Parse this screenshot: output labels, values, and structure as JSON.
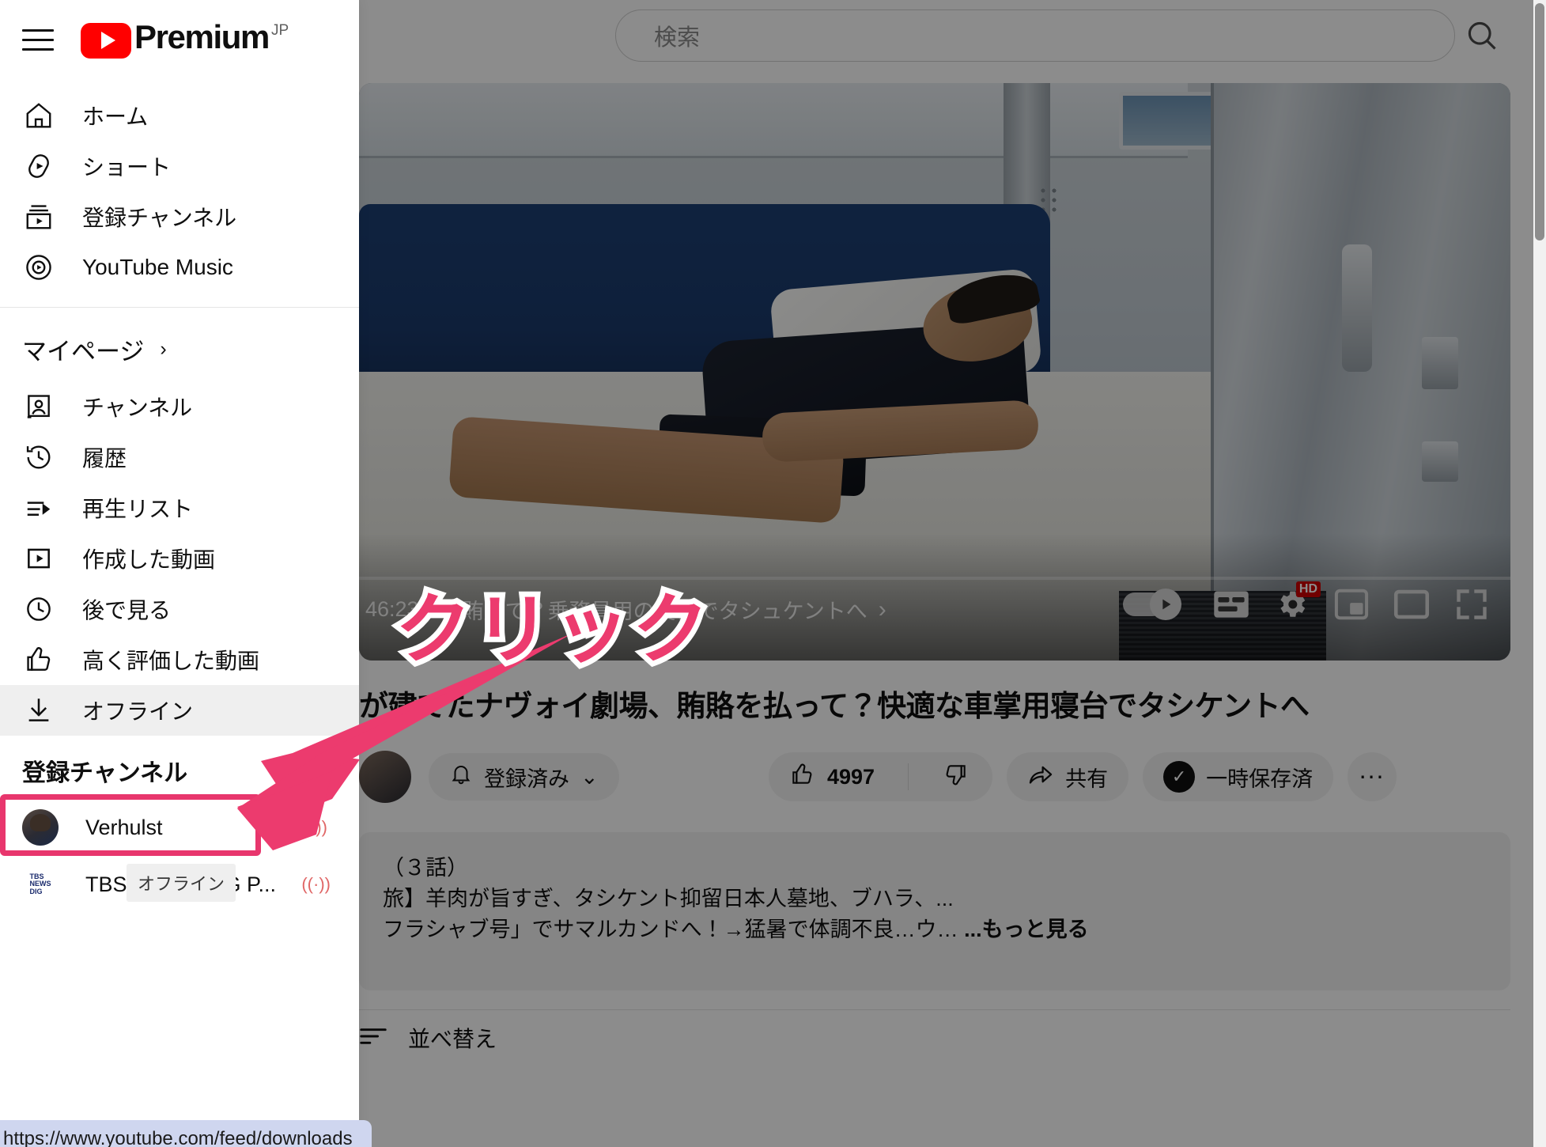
{
  "masthead": {
    "menu_icon": "hamburger-icon",
    "brand": {
      "word": "Premium",
      "superscript": "JP",
      "logo": "youtube-play-logo"
    },
    "search": {
      "placeholder": "検索",
      "value": "",
      "search_icon": "search-icon"
    }
  },
  "sidebar": {
    "primary_items": [
      {
        "label": "ホーム",
        "icon": "home-icon"
      },
      {
        "label": "ショート",
        "icon": "shorts-icon"
      },
      {
        "label": "登録チャンネル",
        "icon": "subscriptions-icon"
      },
      {
        "label": "YouTube Music",
        "icon": "youtube-music-icon"
      }
    ],
    "you_section": {
      "header": "マイページ",
      "chevron": "chevron-right-icon"
    },
    "you_items": [
      {
        "label": "チャンネル",
        "icon": "channel-icon"
      },
      {
        "label": "履歴",
        "icon": "history-icon"
      },
      {
        "label": "再生リスト",
        "icon": "playlist-icon"
      },
      {
        "label": "作成した動画",
        "icon": "your-videos-icon"
      },
      {
        "label": "後で見る",
        "icon": "watch-later-icon"
      },
      {
        "label": "高く評価した動画",
        "icon": "thumbs-up-icon"
      },
      {
        "label": "オフライン",
        "icon": "download-icon"
      }
    ],
    "highlighted_item": "オフライン",
    "tooltip": "オフライン",
    "subscriptions_header": "登録チャンネル",
    "subscriptions": [
      {
        "name": "Verhulst",
        "avatar": "verhulst-avatar",
        "live": true,
        "live_icon": "live-broadcast-icon"
      },
      {
        "name": "TBS NEWS DIG P...",
        "avatar": "tbs-news-dig-avatar",
        "live": true,
        "live_icon": "live-broadcast-icon",
        "logo_lines": [
          "TBS",
          "NEWS",
          "DIG"
        ]
      }
    ]
  },
  "player": {
    "chapter_time": "46:23",
    "chapter_separator": "・",
    "chapter_title": "賄賂で？乗務員用の寝台でタシュケントへ",
    "prev_chapter_icon": "chevron-left-icon",
    "next_chapter_icon": "chevron-right-icon",
    "controls": [
      {
        "name": "autoplay-toggle",
        "icon": "autoplay-toggle-icon",
        "state": "off"
      },
      {
        "name": "subtitles-button",
        "icon": "closed-captions-icon"
      },
      {
        "name": "settings-button",
        "icon": "gear-icon",
        "badge": "HD"
      },
      {
        "name": "miniplayer-button",
        "icon": "miniplayer-icon"
      },
      {
        "name": "theater-button",
        "icon": "theater-mode-icon"
      },
      {
        "name": "fullscreen-button",
        "icon": "fullscreen-icon"
      }
    ],
    "progress_percent": 0
  },
  "video": {
    "title": "が建てたナヴォイ劇場、賄賂を払って？快適な車掌用寝台でタシケントへ",
    "actions": {
      "subscribe_label": "登録済み",
      "bell_icon": "bell-icon",
      "subscribe_chevron": "chevron-down-icon",
      "like_count": "4997",
      "like_icon": "thumbs-up-icon",
      "dislike_icon": "thumbs-down-icon",
      "share_label": "共有",
      "share_icon": "share-arrow-icon",
      "save_label": "一時保存済",
      "save_icon": "downloaded-check-icon",
      "more_label": "...",
      "more_icon": "more-horizontal-icon"
    },
    "description": {
      "line1": "（３話）",
      "line2": "旅】羊肉が旨すぎ、タシケント抑留日本人墓地、ブハラ、...",
      "line3": "フラシャブ号」でサマルカンドへ！→猛暑で体調不良…ウ…",
      "more": "...もっと見る"
    }
  },
  "comments": {
    "sort_label": "並べ替え",
    "sort_icon": "sort-icon"
  },
  "annotation": {
    "text": "クリック",
    "arrow": "arrow-pointing-down-left",
    "color": "#ec3b6e",
    "outline_color": "#ffffff"
  },
  "status_bar": {
    "url": "https://www.youtube.com/feed/downloads"
  },
  "colors": {
    "accent_pink": "#e8366d",
    "youtube_red": "#ff0000",
    "hd_badge": "#cc0000",
    "live_indicator": "#e06666",
    "pill_background": "#f2f2f2",
    "highlight_background": "#efefef"
  }
}
